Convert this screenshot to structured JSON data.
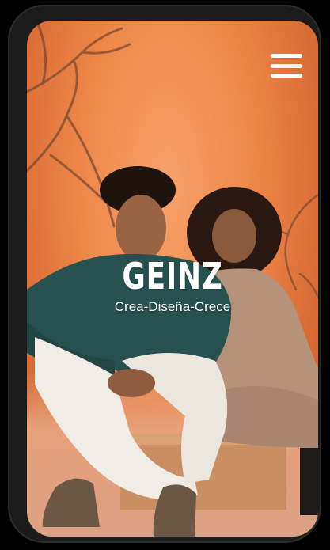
{
  "header": {
    "menu_icon": "hamburger-menu-icon"
  },
  "hero": {
    "brand": "GEINZ",
    "tagline": "Crea-Diseña-Crece"
  },
  "colors": {
    "background": "#ee8648",
    "text": "#ffffff",
    "phone_frame": "#1b1b1b"
  }
}
